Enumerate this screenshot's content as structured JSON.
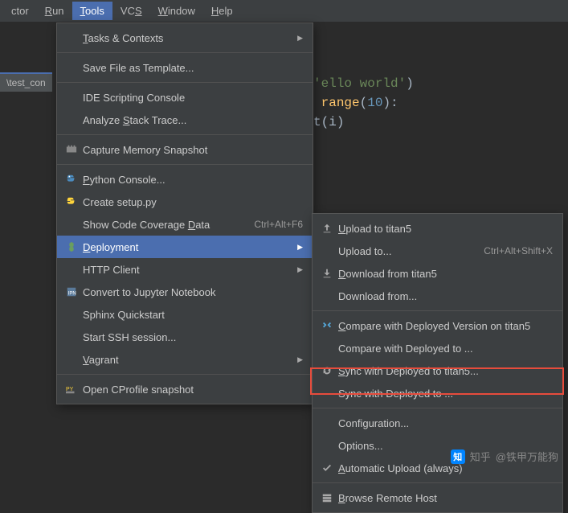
{
  "menubar": {
    "items": [
      {
        "label": "ctor"
      },
      {
        "label": "Run",
        "mn": "R"
      },
      {
        "label": "Tools",
        "mn": "T",
        "active": true
      },
      {
        "label": "VCS",
        "mn": "S"
      },
      {
        "label": "Window",
        "mn": "W"
      },
      {
        "label": "Help",
        "mn": "H"
      }
    ]
  },
  "filetab": {
    "text": "\\test_con"
  },
  "code": {
    "line1_pre": "ello world",
    "line2_func": "range",
    "line2_num": "10",
    "line3_var": "i"
  },
  "tools_menu": {
    "items": [
      {
        "icon": "",
        "label": "Tasks & Contexts",
        "mn": "T",
        "submenu": true
      },
      {
        "sep": true
      },
      {
        "icon": "",
        "label": "Save File as Template..."
      },
      {
        "sep": true
      },
      {
        "icon": "",
        "label": "IDE Scripting Console"
      },
      {
        "icon": "",
        "label": "Analyze Stack Trace...",
        "mn": "S"
      },
      {
        "sep": true
      },
      {
        "icon": "memory",
        "label": "Capture Memory Snapshot"
      },
      {
        "sep": true
      },
      {
        "icon": "pyc",
        "label": "Python Console...",
        "mn": "P"
      },
      {
        "icon": "py",
        "label": "Create setup.py"
      },
      {
        "icon": "",
        "label": "Show Code Coverage Data",
        "mn": "D",
        "shortcut": "Ctrl+Alt+F6"
      },
      {
        "icon": "deploy",
        "label": "Deployment",
        "mn": "D",
        "submenu": true,
        "highlight": true
      },
      {
        "icon": "",
        "label": "HTTP Client",
        "submenu": true
      },
      {
        "icon": "jupyter",
        "label": "Convert to Jupyter Notebook"
      },
      {
        "icon": "",
        "label": "Sphinx Quickstart"
      },
      {
        "icon": "",
        "label": "Start SSH session..."
      },
      {
        "icon": "",
        "label": "Vagrant",
        "mn": "V",
        "submenu": true
      },
      {
        "sep": true
      },
      {
        "icon": "pyprof",
        "label": "Open CProfile snapshot"
      }
    ]
  },
  "deploy_menu": {
    "items": [
      {
        "icon": "upload",
        "label": "Upload to titan5",
        "mn": "U"
      },
      {
        "icon": "",
        "label": "Upload to...",
        "shortcut": "Ctrl+Alt+Shift+X"
      },
      {
        "icon": "download",
        "label": "Download from titan5",
        "mn": "D"
      },
      {
        "icon": "",
        "label": "Download from..."
      },
      {
        "sep": true
      },
      {
        "icon": "compare",
        "label": "Compare with Deployed Version on titan5",
        "mn": "C"
      },
      {
        "icon": "",
        "label": "Compare with Deployed to ..."
      },
      {
        "icon": "sync",
        "label": "Sync with Deployed to titan5...",
        "mn": "S"
      },
      {
        "icon": "",
        "label": "Sync with Deployed to ..."
      },
      {
        "sep": true
      },
      {
        "icon": "",
        "label": "Configuration...",
        "redbox": true
      },
      {
        "icon": "",
        "label": "Options..."
      },
      {
        "icon": "check",
        "label": "Automatic Upload (always)",
        "mn": "A"
      },
      {
        "sep": true
      },
      {
        "icon": "host",
        "label": "Browse Remote Host",
        "mn": "B"
      }
    ]
  },
  "watermark": {
    "brand": "知乎",
    "handle": "@铁甲万能狗"
  }
}
